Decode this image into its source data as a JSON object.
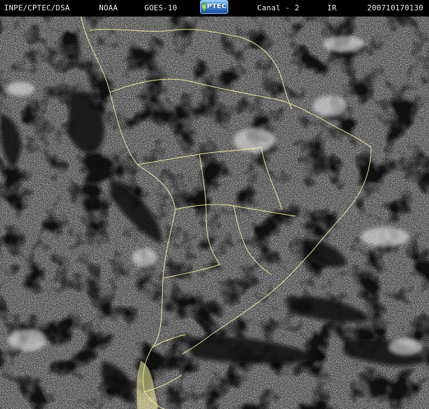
{
  "header": {
    "organization": "INPE/CPTEC/DSA",
    "agency": "NOAA",
    "satellite": "GOES-10",
    "logo_text": "CPTEC",
    "channel": "Canal - 2",
    "band": "IR",
    "timestamp": "200710170130"
  },
  "image": {
    "description_key": "satellite-infrared-imagery",
    "colors": {
      "background": "#000000",
      "clouds": "#ffffff",
      "borders": "#fff5a5"
    }
  }
}
